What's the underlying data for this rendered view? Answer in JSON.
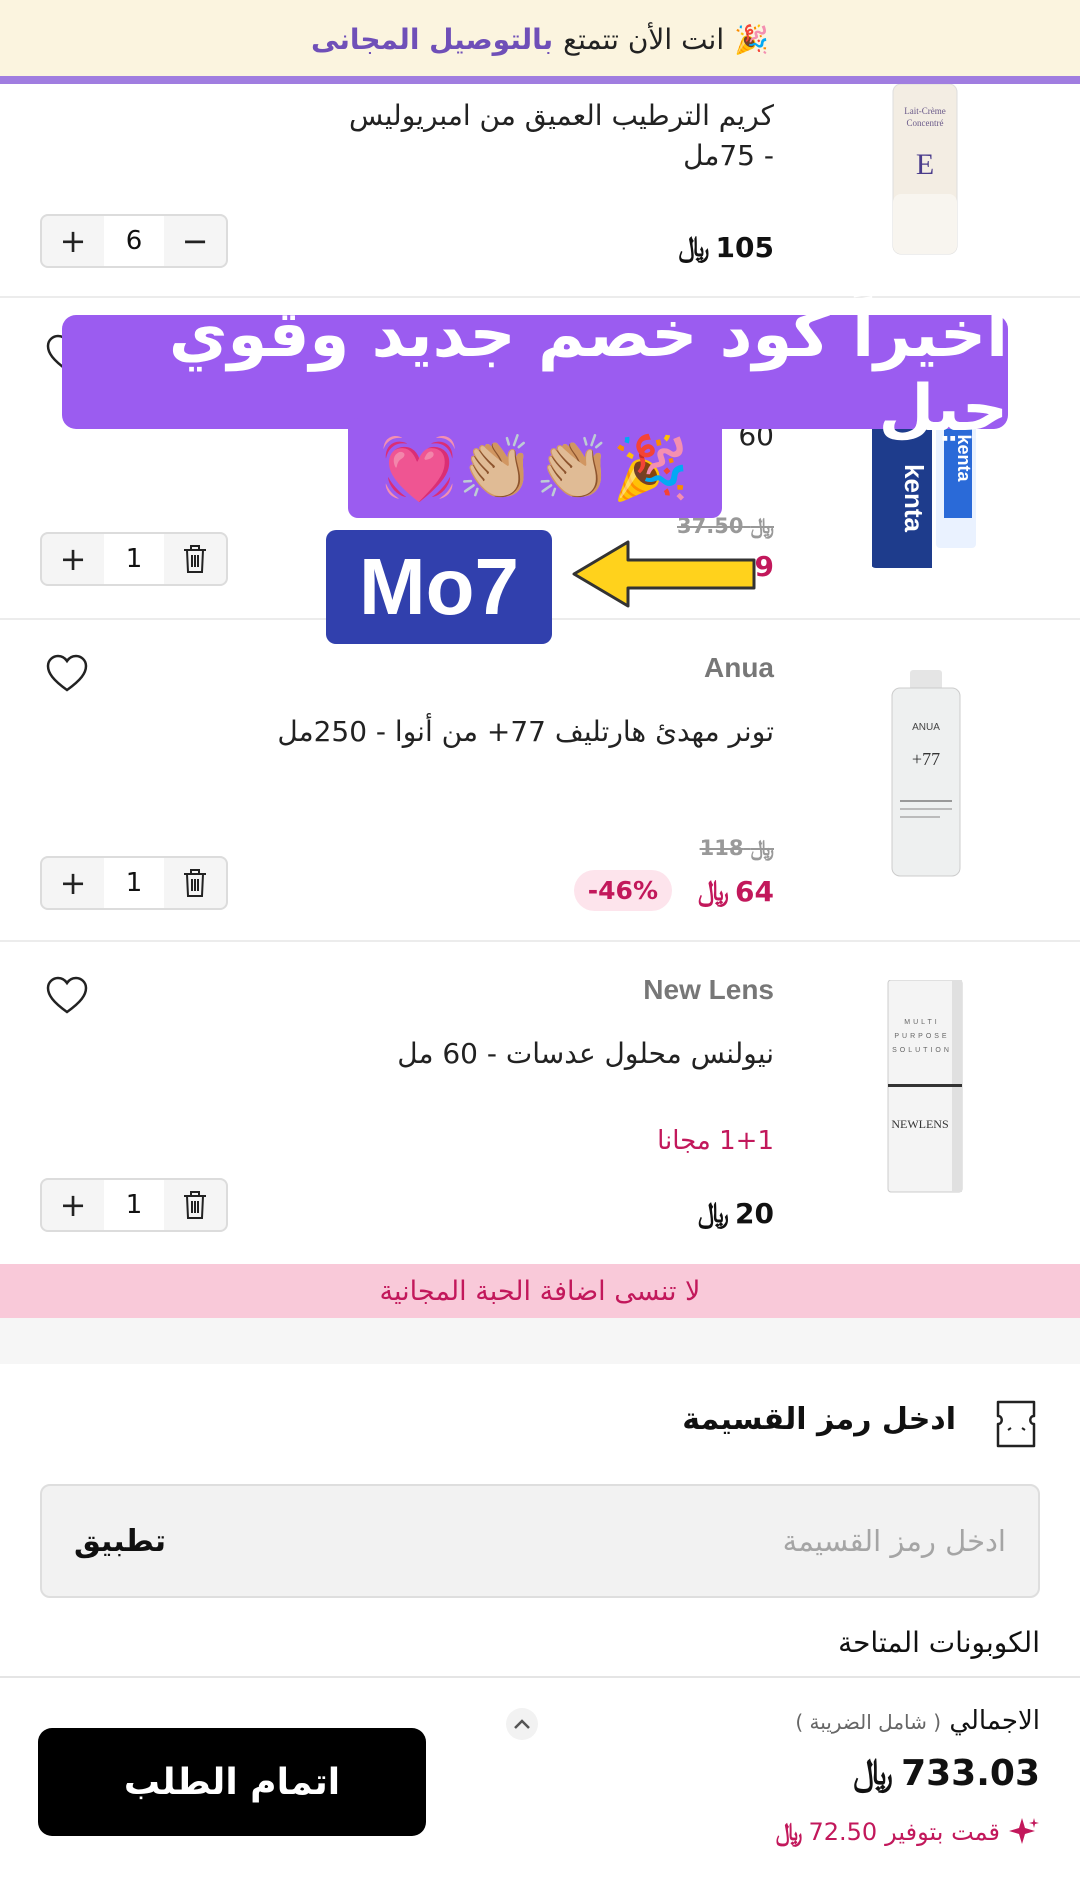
{
  "top_banner": {
    "prefix": "انت الأن تتمتع",
    "highlight": "بالتوصيل المجانى",
    "emoji": "🎉"
  },
  "currency_symbol": "﷼",
  "items": [
    {
      "name_line1": "كريم الترطيب العميق من امبريوليس",
      "name_line2": "- 75مل",
      "price": "105",
      "quantity": "6"
    },
    {
      "name_line2": "60",
      "old_price": "37.50",
      "price": "9",
      "quantity": "1"
    },
    {
      "brand": "Anua",
      "name": "تونر مهدئ هارتليف 77+ من أنوا - 250مل",
      "old_price": "118",
      "price": "64",
      "discount": "-46%",
      "quantity": "1"
    },
    {
      "brand": "New Lens",
      "name": "نيولنس محلول عدسات - 60 مل",
      "promo": "1+1 مجانا",
      "price": "20",
      "quantity": "1"
    }
  ],
  "overlay": {
    "headline": "اخيراً كود خصم جديد وقوي حيل",
    "emojis": "💓👏🏼👏🏼🎉",
    "code": "Mo7"
  },
  "pink_banner": "لا تنسى اضافة الحبة المجانية",
  "coupon": {
    "title": "ادخل رمز القسيمة",
    "placeholder": "ادخل رمز القسيمة",
    "apply_label": "تطبيق",
    "available_label": "الكوبونات المتاحة"
  },
  "footer": {
    "checkout_label": "اتمام الطلب",
    "total_label": "الاجمالي",
    "total_sub": "( شامل الضريبة )",
    "total_value": "733.03",
    "saved_label": "قمت بتوفير",
    "saved_value": "72.50"
  },
  "colors": {
    "accent_purple": "#9b5cf0",
    "code_blue": "#3140ad",
    "sale_red": "#c2185b",
    "banner_pink": "#f9c9d9"
  }
}
